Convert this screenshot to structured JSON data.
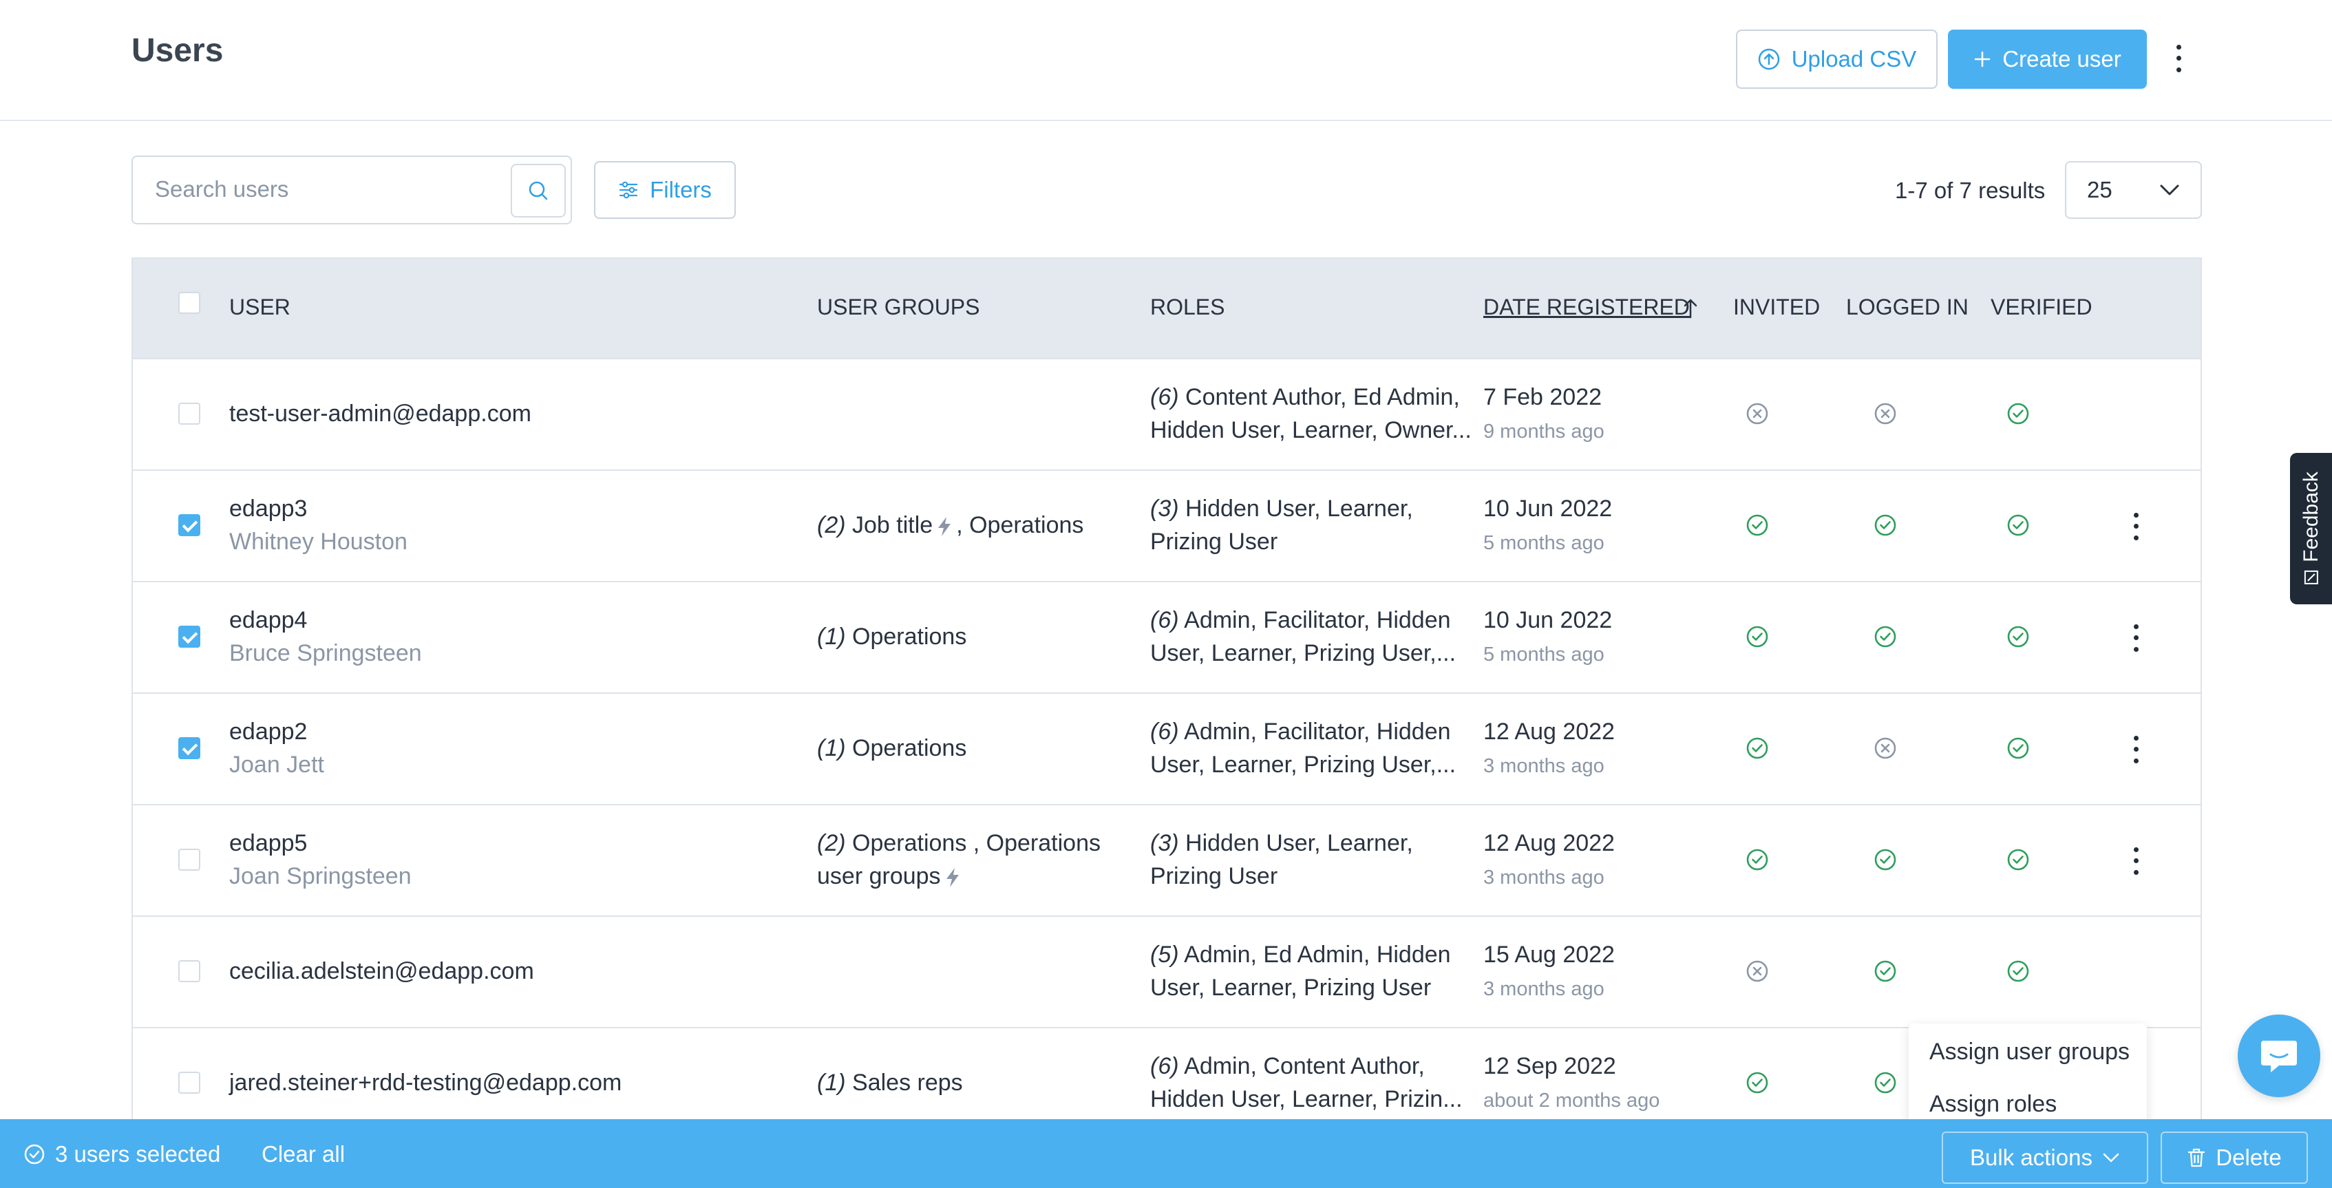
{
  "header": {
    "title": "Users",
    "upload_label": "Upload CSV",
    "create_label": "Create user"
  },
  "toolbar": {
    "search_placeholder": "Search users",
    "filters_label": "Filters",
    "results_text": "1-7 of 7 results",
    "per_page": "25"
  },
  "table": {
    "columns": {
      "user": "USER",
      "groups": "USER GROUPS",
      "roles": "ROLES",
      "date": "DATE REGISTERED",
      "invited": "INVITED",
      "logged_in": "LOGGED IN",
      "verified": "VERIFIED"
    },
    "rows": [
      {
        "checked": false,
        "primary": "test-user-admin@edapp.com",
        "secondary": "",
        "groups_count": "",
        "groups_line1": "",
        "groups_line2": "",
        "roles_count": "(6)",
        "roles_line1": "Content Author, Ed Admin,",
        "roles_line2": "Hidden User, Learner, Owner...",
        "date": "7 Feb 2022",
        "ago": "9 months ago",
        "invited": false,
        "logged_in": false,
        "verified": true,
        "menu": false
      },
      {
        "checked": true,
        "primary": "edapp3",
        "secondary": "Whitney Houston",
        "groups_count": "(2)",
        "groups_line1": "Job title",
        "groups_line1b": ", Operations",
        "groups_line2": "",
        "roles_count": "(3)",
        "roles_line1": "Hidden User, Learner,",
        "roles_line2": "Prizing User",
        "date": "10 Jun 2022",
        "ago": "5 months ago",
        "invited": true,
        "logged_in": true,
        "verified": true,
        "menu": true
      },
      {
        "checked": true,
        "primary": "edapp4",
        "secondary": "Bruce Springsteen",
        "groups_count": "(1)",
        "groups_line1": "Operations",
        "groups_line2": "",
        "roles_count": "(6)",
        "roles_line1": "Admin, Facilitator, Hidden",
        "roles_line2": "User, Learner, Prizing User,...",
        "date": "10 Jun 2022",
        "ago": "5 months ago",
        "invited": true,
        "logged_in": true,
        "verified": true,
        "menu": true
      },
      {
        "checked": true,
        "primary": "edapp2",
        "secondary": "Joan Jett",
        "groups_count": "(1)",
        "groups_line1": "Operations",
        "groups_line2": "",
        "roles_count": "(6)",
        "roles_line1": "Admin, Facilitator, Hidden",
        "roles_line2": "User, Learner, Prizing User,...",
        "date": "12 Aug 2022",
        "ago": "3 months ago",
        "invited": true,
        "logged_in": false,
        "verified": true,
        "menu": true
      },
      {
        "checked": false,
        "primary": "edapp5",
        "secondary": "Joan Springsteen",
        "groups_count": "(2)",
        "groups_line1": "Operations , Operations",
        "groups_line2": "user groups",
        "roles_count": "(3)",
        "roles_line1": "Hidden User, Learner,",
        "roles_line2": "Prizing User",
        "date": "12 Aug 2022",
        "ago": "3 months ago",
        "invited": true,
        "logged_in": true,
        "verified": true,
        "menu": true
      },
      {
        "checked": false,
        "primary": "cecilia.adelstein@edapp.com",
        "secondary": "",
        "groups_count": "",
        "groups_line1": "",
        "groups_line2": "",
        "roles_count": "(5)",
        "roles_line1": "Admin, Ed Admin, Hidden",
        "roles_line2": "User, Learner, Prizing User",
        "date": "15 Aug 2022",
        "ago": "3 months ago",
        "invited": false,
        "logged_in": true,
        "verified": true,
        "menu": false
      },
      {
        "checked": false,
        "primary": "jared.steiner+rdd-testing@edapp.com",
        "secondary": "",
        "groups_count": "(1)",
        "groups_line1": "Sales reps",
        "groups_line2": "",
        "roles_count": "(6)",
        "roles_line1": "Admin, Content Author,",
        "roles_line2": "Hidden User, Learner, Prizin...",
        "date": "12 Sep 2022",
        "ago": "about 2 months ago",
        "invited": true,
        "logged_in": true,
        "verified": true,
        "menu": false
      }
    ]
  },
  "feedback_label": "Feedback",
  "dropdown": {
    "items": [
      "Assign user groups",
      "Assign roles"
    ]
  },
  "bulk_bar": {
    "selected_text": "3 users selected",
    "clear_label": "Clear all",
    "bulk_label": "Bulk actions",
    "delete_label": "Delete"
  },
  "colors": {
    "accent": "#4bb0f0",
    "success": "#2e9e5a",
    "muted": "#8b96a5",
    "header_bg": "#e4e8ef"
  }
}
